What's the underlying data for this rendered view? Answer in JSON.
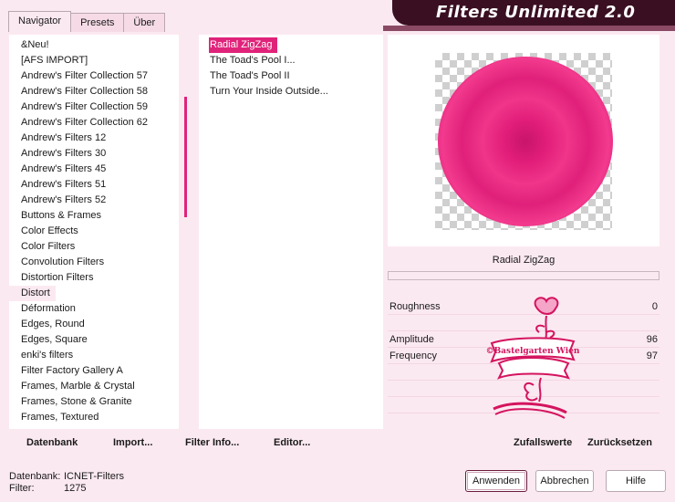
{
  "tabs": [
    {
      "label": "Navigator",
      "active": true
    },
    {
      "label": "Presets",
      "active": false
    },
    {
      "label": "Über",
      "active": false
    }
  ],
  "app_title": "Filters Unlimited 2.0",
  "categories": [
    "&Neu!",
    "[AFS IMPORT]",
    "Andrew's Filter Collection 57",
    "Andrew's Filter Collection 58",
    "Andrew's Filter Collection 59",
    "Andrew's Filter Collection 62",
    "Andrew's Filters 12",
    "Andrew's Filters 30",
    "Andrew's Filters 45",
    "Andrew's Filters 51",
    "Andrew's Filters 52",
    "Buttons & Frames",
    "Color Effects",
    "Color Filters",
    "Convolution Filters",
    "Distortion Filters",
    "Distort",
    "Déformation",
    "Edges, Round",
    "Edges, Square",
    "enki's filters",
    "Filter Factory Gallery A",
    "Frames, Marble & Crystal",
    "Frames, Stone & Granite",
    "Frames, Textured"
  ],
  "selected_category": "Distort",
  "filters": [
    "Radial ZigZag",
    "The Toad's Pool I...",
    "The Toad's Pool II",
    "Turn Your Inside Outside..."
  ],
  "selected_filter": "Radial ZigZag",
  "preview": {
    "filter_name": "Radial ZigZag",
    "progress": 0
  },
  "params": [
    {
      "label": "Roughness",
      "value": "0"
    },
    {
      "label": "",
      "value": ""
    },
    {
      "label": "Amplitude",
      "value": "96"
    },
    {
      "label": "Frequency",
      "value": "97"
    }
  ],
  "watermark": {
    "text": "©Bastelgarten Wien"
  },
  "bottom_buttons": {
    "datenbank": "Datenbank",
    "import": "Import...",
    "filter_info": "Filter Info...",
    "editor": "Editor...",
    "zufallswerte": "Zufallswerte",
    "zuruecksetzen": "Zurücksetzen"
  },
  "status": {
    "db_label": "Datenbank:",
    "db_value": "ICNET-Filters",
    "filter_label": "Filter:",
    "filter_value": "1275"
  },
  "dialog_buttons": {
    "apply": "Anwenden",
    "cancel": "Abbrechen",
    "help": "Hilfe"
  },
  "colors": {
    "accent": "#e0237a",
    "background": "#fbe9f1",
    "title_bar": "#3a0f22"
  }
}
